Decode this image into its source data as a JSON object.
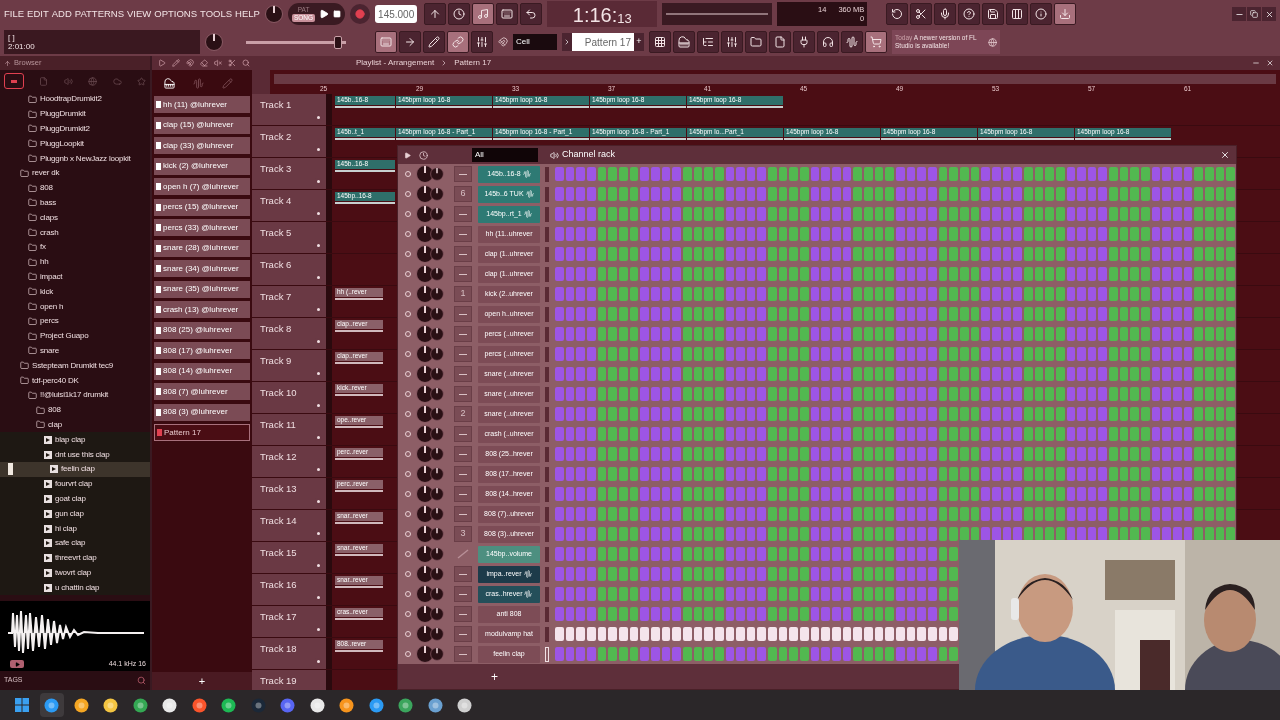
{
  "menu": [
    "FILE",
    "EDIT",
    "ADD",
    "PATTERNS",
    "VIEW",
    "OPTIONS",
    "TOOLS",
    "HELP"
  ],
  "transport": {
    "modes": [
      {
        "label": "PAT",
        "selected": false
      },
      {
        "label": "SONG",
        "selected": true
      }
    ],
    "tempo": "145.000",
    "time_main": "1:16:",
    "time_sub": "13"
  },
  "monitor": {
    "cpu": "14",
    "ram": "360 MB",
    "polyphony": "0"
  },
  "hint": {
    "bracket": "[ ]",
    "value": "2:01:00"
  },
  "master_volume": {
    "level": 0.92
  },
  "snap": "Cell",
  "pattern": "Pattern 17",
  "pattern_add": "+",
  "news": {
    "date": "Today",
    "message": "A newer version of FL Studio is available!"
  },
  "browser": {
    "title": "Browser",
    "partial_folder_items": [
      {
        "label": "HoodtrapDrumkit2",
        "kind": "folder"
      },
      {
        "label": "PluggDrumkit",
        "kind": "folder"
      },
      {
        "label": "PluggDrumkit2",
        "kind": "folder"
      },
      {
        "label": "PluggLoopkit",
        "kind": "folder"
      },
      {
        "label": "Pluggnb x NewJazz loopkit",
        "kind": "folder"
      }
    ],
    "tree": [
      {
        "label": "rever dk",
        "kind": "folder",
        "children": [
          {
            "label": "808",
            "kind": "folder"
          },
          {
            "label": "bass",
            "kind": "folder"
          },
          {
            "label": "claps",
            "kind": "folder"
          },
          {
            "label": "crash",
            "kind": "folder"
          },
          {
            "label": "fx",
            "kind": "folder"
          },
          {
            "label": "hh",
            "kind": "folder"
          },
          {
            "label": "impact",
            "kind": "folder"
          },
          {
            "label": "kick",
            "kind": "folder"
          },
          {
            "label": "open h",
            "kind": "folder"
          },
          {
            "label": "percs",
            "kind": "folder"
          },
          {
            "label": "Project Guapo",
            "kind": "folder"
          },
          {
            "label": "snare",
            "kind": "folder"
          }
        ]
      },
      {
        "label": "Sstepteam Drumkit tec9",
        "kind": "folder"
      },
      {
        "label": "tdf-perc40 DK",
        "kind": "folder",
        "children": [
          {
            "label": "!!@luisi1k17 drumkit",
            "kind": "folder",
            "children": [
              {
                "label": "808",
                "kind": "folder"
              },
              {
                "label": "clap",
                "kind": "folder",
                "children": [
                  {
                    "label": "blap clap",
                    "kind": "file",
                    "selected": false
                  },
                  {
                    "label": "dnt use this clap",
                    "kind": "file",
                    "selected": false
                  },
                  {
                    "label": "feelin clap",
                    "kind": "file",
                    "selected": true
                  },
                  {
                    "label": "fourvrt clap",
                    "kind": "file",
                    "selected": false
                  },
                  {
                    "label": "goat clap",
                    "kind": "file",
                    "selected": false
                  },
                  {
                    "label": "gun clap",
                    "kind": "file",
                    "selected": false
                  },
                  {
                    "label": "hi clap",
                    "kind": "file",
                    "selected": false
                  },
                  {
                    "label": "safe clap",
                    "kind": "file",
                    "selected": false
                  },
                  {
                    "label": "threevrt clap",
                    "kind": "file",
                    "selected": false
                  },
                  {
                    "label": "twovrt clap",
                    "kind": "file",
                    "selected": false
                  },
                  {
                    "label": "u chattin clap",
                    "kind": "file",
                    "selected": false
                  }
                ]
              }
            ]
          }
        ]
      }
    ],
    "sample_info": "44.1 kHz 16",
    "tags_label": "TAGS"
  },
  "patterns": [
    {
      "label": "hh (11) @luhrever",
      "selected": false
    },
    {
      "label": "clap (15) @luhrever",
      "selected": false
    },
    {
      "label": "clap (33) @luhrever",
      "selected": false
    },
    {
      "label": "kick (2) @luhrever",
      "selected": false
    },
    {
      "label": "open h (7) @luhrever",
      "selected": false
    },
    {
      "label": "percs (15) @luhrever",
      "selected": false
    },
    {
      "label": "percs (33) @luhrever",
      "selected": false
    },
    {
      "label": "snare (28) @luhrever",
      "selected": false
    },
    {
      "label": "snare (34) @luhrever",
      "selected": false
    },
    {
      "label": "snare (35) @luhrever",
      "selected": false
    },
    {
      "label": "crash (13) @luhrever",
      "selected": false
    },
    {
      "label": "808 (25) @luhrever",
      "selected": false
    },
    {
      "label": "808 (17) @luhrever",
      "selected": false
    },
    {
      "label": "808 (14) @luhrever",
      "selected": false
    },
    {
      "label": "808 (7) @luhrever",
      "selected": false
    },
    {
      "label": "808 (3) @luhrever",
      "selected": false
    },
    {
      "label": "Pattern 17",
      "selected": true
    }
  ],
  "playlist": {
    "title": "Playlist - Arrangement",
    "pattern": "Pattern 17",
    "bars": [
      "25",
      "29",
      "33",
      "37",
      "41",
      "45",
      "49",
      "53",
      "57",
      "61"
    ],
    "tracks": [
      {
        "name": "Track 1",
        "clips": [
          {
            "label": "145b..16-8",
            "kind": "fragment"
          },
          {
            "label": "145bpm loop 16-8",
            "kind": "audio"
          },
          {
            "label": "145bpm loop 16-8",
            "kind": "audio"
          },
          {
            "label": "145bpm loop 16-8",
            "kind": "audio"
          },
          {
            "label": "145bpm loop 16-8",
            "kind": "audio"
          }
        ]
      },
      {
        "name": "Track 2",
        "clips": [
          {
            "label": "145b..t_1",
            "kind": "fragment"
          },
          {
            "label": "145bpm loop 16-8 - Part_1",
            "kind": "audio"
          },
          {
            "label": "145bpm loop 16-8 - Part_1",
            "kind": "audio"
          },
          {
            "label": "145bpm loop 16-8 - Part_1",
            "kind": "audio"
          },
          {
            "label": "145bpm lo...Part_1",
            "kind": "audio"
          },
          {
            "label": "145bpm loop 16-8",
            "kind": "audio"
          },
          {
            "label": "145bpm loop 16-8",
            "kind": "audio"
          },
          {
            "label": "145bpm loop 16-8",
            "kind": "audio"
          },
          {
            "label": "145bpm loop 16-8",
            "kind": "audio"
          }
        ]
      },
      {
        "name": "Track 3",
        "clips": [
          {
            "label": "145b..16-8",
            "kind": "fragment"
          }
        ]
      },
      {
        "name": "Track 4",
        "clips": [
          {
            "label": "145bp..16-8",
            "kind": "fragment"
          }
        ]
      },
      {
        "name": "Track 5"
      },
      {
        "name": "Track 6"
      },
      {
        "name": "Track 7",
        "clips": [
          {
            "label": "hh (..rever",
            "kind": "pattern"
          }
        ]
      },
      {
        "name": "Track 8",
        "clips": [
          {
            "label": "clap..rever",
            "kind": "pattern"
          }
        ]
      },
      {
        "name": "Track 9",
        "clips": [
          {
            "label": "clap..rever",
            "kind": "pattern"
          }
        ]
      },
      {
        "name": "Track 10",
        "clips": [
          {
            "label": "kick..rever",
            "kind": "pattern"
          }
        ]
      },
      {
        "name": "Track 11",
        "clips": [
          {
            "label": "ope..rever",
            "kind": "pattern"
          }
        ]
      },
      {
        "name": "Track 12",
        "clips": [
          {
            "label": "perc..rever",
            "kind": "pattern"
          }
        ]
      },
      {
        "name": "Track 13",
        "clips": [
          {
            "label": "perc..rever",
            "kind": "pattern"
          }
        ]
      },
      {
        "name": "Track 14",
        "clips": [
          {
            "label": "snar..rever",
            "kind": "pattern"
          }
        ]
      },
      {
        "name": "Track 15",
        "clips": [
          {
            "label": "snar..rever",
            "kind": "pattern"
          }
        ]
      },
      {
        "name": "Track 16",
        "clips": [
          {
            "label": "snar..rever",
            "kind": "pattern"
          }
        ]
      },
      {
        "name": "Track 17",
        "clips": [
          {
            "label": "cras..rever",
            "kind": "pattern"
          }
        ]
      },
      {
        "name": "Track 18",
        "clips": [
          {
            "label": "808..rever",
            "kind": "pattern"
          }
        ]
      },
      {
        "name": "Track 19"
      }
    ]
  },
  "channel_rack": {
    "filter": "All",
    "title": "Channel rack",
    "add": "+",
    "channels": [
      {
        "name": "145b..16-8",
        "kind": "audio",
        "color": "#2e7a74",
        "selected": false,
        "steps_lit": false
      },
      {
        "name": "145b..6 TUK",
        "kind": "audio",
        "color": "#2e7a74",
        "track": "6",
        "selected": false,
        "steps_lit": false
      },
      {
        "name": "145bp..rt_1",
        "kind": "audio",
        "color": "#2e7a74",
        "selected": false,
        "steps_lit": false
      },
      {
        "name": "hh (11..uhrever",
        "kind": "sampler",
        "selected": false,
        "steps_lit": false
      },
      {
        "name": "clap (1..uhrever",
        "kind": "sampler",
        "selected": false,
        "steps_lit": false
      },
      {
        "name": "clap (1..uhrever",
        "kind": "sampler",
        "selected": false,
        "steps_lit": false
      },
      {
        "name": "kick (2..uhrever",
        "kind": "sampler",
        "track": "1",
        "selected": false,
        "steps_lit": false
      },
      {
        "name": "open h..uhrever",
        "kind": "sampler",
        "selected": false,
        "steps_lit": false
      },
      {
        "name": "percs (..uhrever",
        "kind": "sampler",
        "selected": false,
        "steps_lit": false
      },
      {
        "name": "percs (..uhrever",
        "kind": "sampler",
        "selected": false,
        "steps_lit": false
      },
      {
        "name": "snare (..uhrever",
        "kind": "sampler",
        "selected": false,
        "steps_lit": false
      },
      {
        "name": "snare (..uhrever",
        "kind": "sampler",
        "selected": false,
        "steps_lit": false
      },
      {
        "name": "snare (..uhrever",
        "kind": "sampler",
        "track": "2",
        "selected": false,
        "steps_lit": false
      },
      {
        "name": "crash (..uhrever",
        "kind": "sampler",
        "selected": false,
        "steps_lit": false
      },
      {
        "name": "808 (25..hrever",
        "kind": "sampler",
        "selected": false,
        "steps_lit": false
      },
      {
        "name": "808 (17..hrever",
        "kind": "sampler",
        "selected": false,
        "steps_lit": false
      },
      {
        "name": "808 (14..hrever",
        "kind": "sampler",
        "selected": false,
        "steps_lit": false
      },
      {
        "name": "808 (7)..uhrever",
        "kind": "sampler",
        "selected": false,
        "steps_lit": false
      },
      {
        "name": "808 (3)..uhrever",
        "kind": "sampler",
        "track": "3",
        "selected": false,
        "steps_lit": false
      },
      {
        "name": "145bp..volume",
        "kind": "automation",
        "color": "#4d8f80",
        "selected": false,
        "steps_lit": false
      },
      {
        "name": "impa..rever",
        "kind": "audio",
        "color": "#1d3b4a",
        "selected": false,
        "steps_lit": false
      },
      {
        "name": "cras..hrever",
        "kind": "audio",
        "color": "#244f5a",
        "selected": false,
        "steps_lit": false
      },
      {
        "name": "anti 808",
        "kind": "sampler",
        "selected": false,
        "steps_lit": false
      },
      {
        "name": "modulvamp hat",
        "kind": "sampler",
        "selected": false,
        "steps_lit": true
      },
      {
        "name": "feelin clap",
        "kind": "sampler",
        "selected": true,
        "steps_lit": false
      }
    ]
  }
}
